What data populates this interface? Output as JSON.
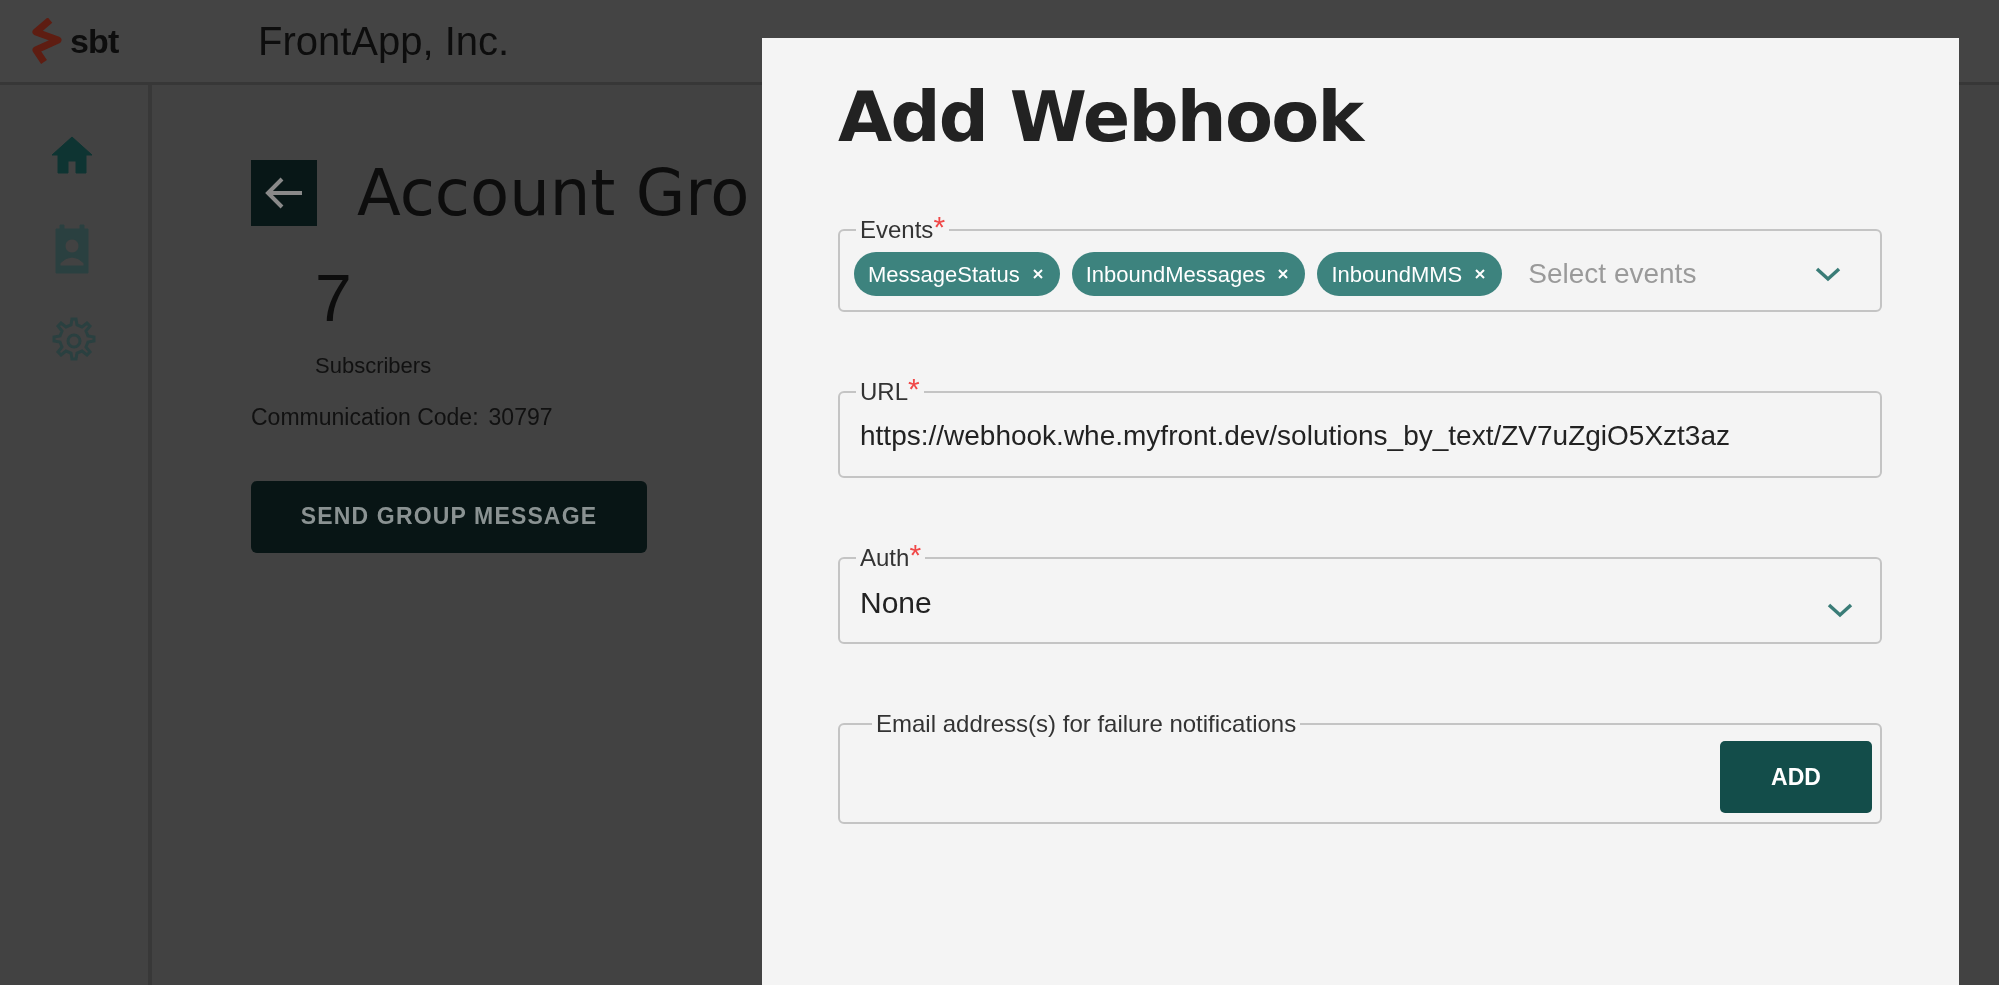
{
  "header": {
    "logo_text": "sbt",
    "company": "FrontApp, Inc."
  },
  "sidebar": {
    "items": [
      {
        "kind": "home",
        "selected": true
      },
      {
        "kind": "contacts",
        "selected": false
      },
      {
        "kind": "settings",
        "selected": false
      }
    ]
  },
  "page": {
    "title": "Account Gro",
    "count": "7",
    "count_label": "Subscribers",
    "code_label": "Communication Code:",
    "code_value": "30797",
    "button": "SEND GROUP MESSAGE"
  },
  "modal": {
    "title": "Add Webhook",
    "fields": [
      {
        "kind": "multiselect",
        "label": "Events",
        "required_mark": "*",
        "chips": [
          "MessageStatus",
          "InboundMessages",
          "InboundMMS"
        ],
        "placeholder": "Select events"
      },
      {
        "kind": "text",
        "label": "URL",
        "required_mark": "*",
        "value": "https://webhook.whe.myfront.dev/solutions_by_text/ZV7uZgiO5Xzt3az"
      },
      {
        "kind": "select",
        "label": "Auth",
        "required_mark": "*",
        "value": "None"
      },
      {
        "kind": "email",
        "label": "Email address(s) for failure notifications",
        "button": "ADD"
      }
    ]
  }
}
